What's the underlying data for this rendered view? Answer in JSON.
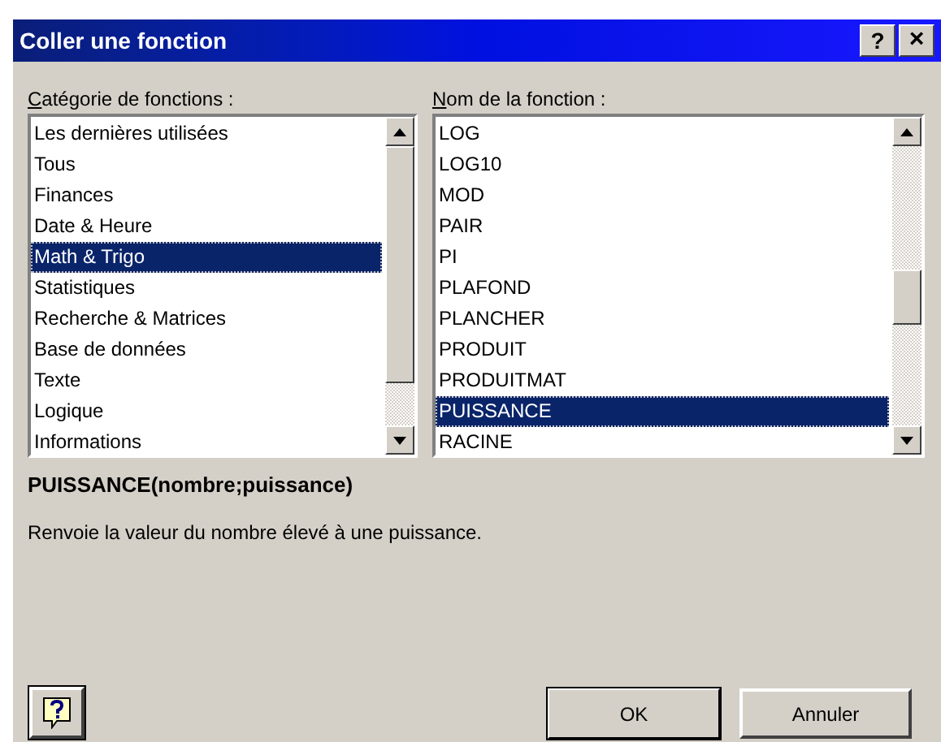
{
  "window": {
    "title": "Coller une fonction"
  },
  "categories": {
    "label": "Catégorie de fonctions :",
    "items": [
      {
        "label": "Les dernières utilisées",
        "selected": false
      },
      {
        "label": "Tous",
        "selected": false
      },
      {
        "label": "Finances",
        "selected": false
      },
      {
        "label": "Date & Heure",
        "selected": false
      },
      {
        "label": "Math & Trigo",
        "selected": true
      },
      {
        "label": "Statistiques",
        "selected": false
      },
      {
        "label": "Recherche & Matrices",
        "selected": false
      },
      {
        "label": "Base de données",
        "selected": false
      },
      {
        "label": "Texte",
        "selected": false
      },
      {
        "label": "Logique",
        "selected": false
      },
      {
        "label": "Informations",
        "selected": false
      }
    ]
  },
  "functions": {
    "label": "Nom de la fonction :",
    "items": [
      {
        "label": "LOG",
        "selected": false
      },
      {
        "label": "LOG10",
        "selected": false
      },
      {
        "label": "MOD",
        "selected": false
      },
      {
        "label": "PAIR",
        "selected": false
      },
      {
        "label": "PI",
        "selected": false
      },
      {
        "label": "PLAFOND",
        "selected": false
      },
      {
        "label": "PLANCHER",
        "selected": false
      },
      {
        "label": "PRODUIT",
        "selected": false
      },
      {
        "label": "PRODUITMAT",
        "selected": false
      },
      {
        "label": "PUISSANCE",
        "selected": true
      },
      {
        "label": "RACINE",
        "selected": false
      }
    ]
  },
  "syntax": "PUISSANCE(nombre;puissance)",
  "description": "Renvoie la valeur du nombre élevé à une puissance.",
  "buttons": [
    "OK",
    "Annuler"
  ],
  "title_buttons": [
    "?",
    "×"
  ]
}
